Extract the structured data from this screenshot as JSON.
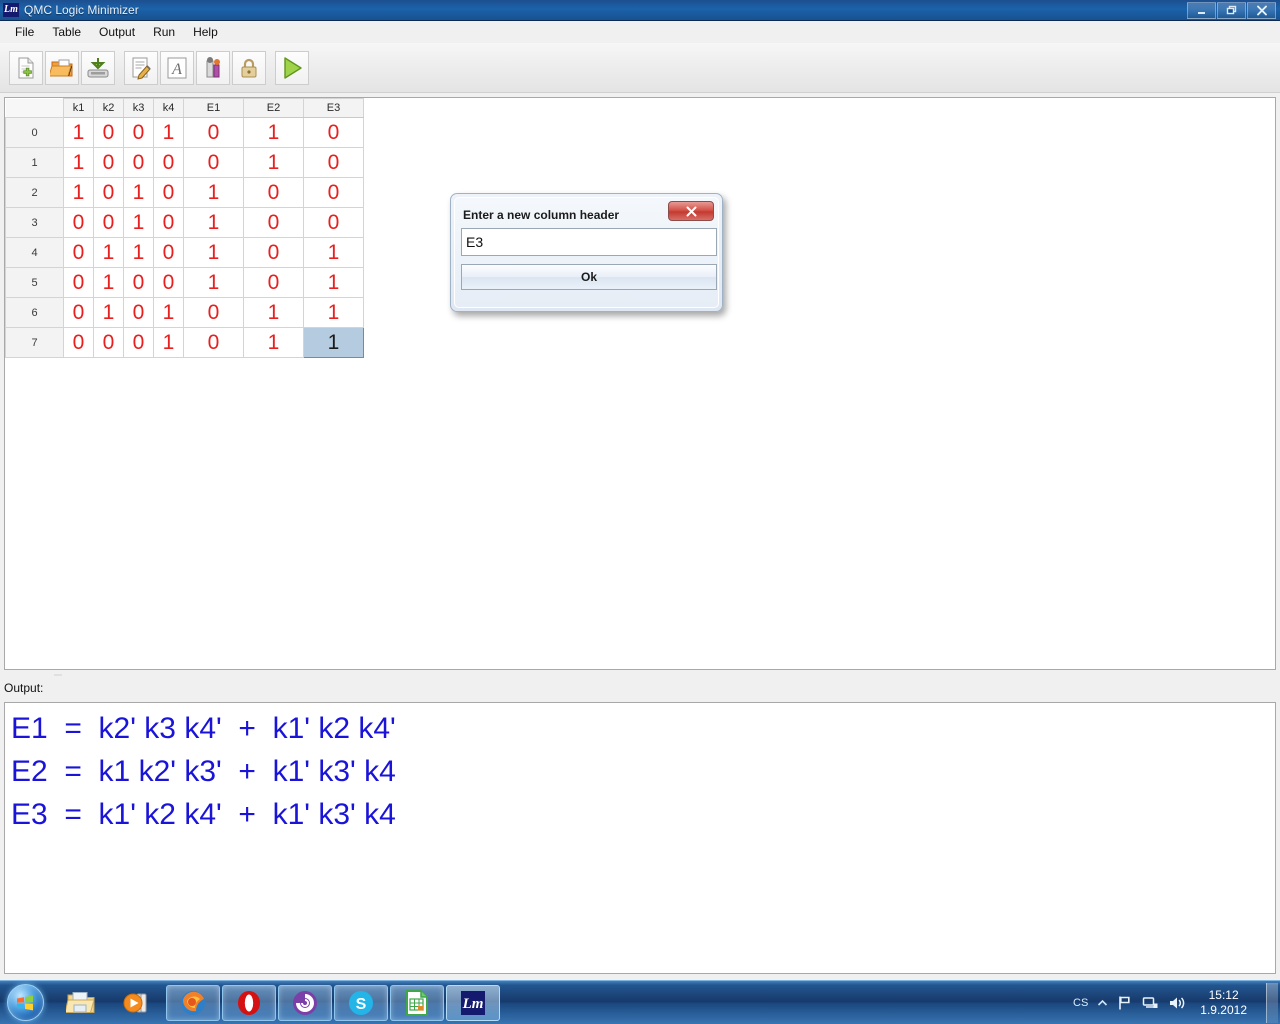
{
  "window": {
    "title": "QMC Logic Minimizer",
    "icon_label": "Lm",
    "controls": {
      "minimize": "—",
      "restore": "❐",
      "close": "✕"
    }
  },
  "menu": {
    "items": [
      {
        "label": "File"
      },
      {
        "label": "Table"
      },
      {
        "label": "Output"
      },
      {
        "label": "Run"
      },
      {
        "label": "Help"
      }
    ]
  },
  "toolbar": {
    "buttons": [
      {
        "name": "new-file-icon",
        "tip": "New"
      },
      {
        "name": "open-folder-icon",
        "tip": "Open"
      },
      {
        "name": "save-disk-icon",
        "tip": "Save"
      },
      {
        "name": "edit-note-icon",
        "tip": "Edit"
      },
      {
        "name": "font-letter-icon",
        "tip": "Font"
      },
      {
        "name": "color-chart-icon",
        "tip": "Colors"
      },
      {
        "name": "lock-icon",
        "tip": "Lock"
      },
      {
        "name": "run-play-icon",
        "tip": "Run"
      }
    ]
  },
  "table": {
    "corner_label": "",
    "columns": [
      "k1",
      "k2",
      "k3",
      "k4",
      "E1",
      "E2",
      "E3"
    ],
    "rows": [
      {
        "index": "0",
        "values": [
          "1",
          "0",
          "0",
          "1",
          "0",
          "1",
          "0"
        ]
      },
      {
        "index": "1",
        "values": [
          "1",
          "0",
          "0",
          "0",
          "0",
          "1",
          "0"
        ]
      },
      {
        "index": "2",
        "values": [
          "1",
          "0",
          "1",
          "0",
          "1",
          "0",
          "0"
        ]
      },
      {
        "index": "3",
        "values": [
          "0",
          "0",
          "1",
          "0",
          "1",
          "0",
          "0"
        ]
      },
      {
        "index": "4",
        "values": [
          "0",
          "1",
          "1",
          "0",
          "1",
          "0",
          "1"
        ]
      },
      {
        "index": "5",
        "values": [
          "0",
          "1",
          "0",
          "0",
          "1",
          "0",
          "1"
        ]
      },
      {
        "index": "6",
        "values": [
          "0",
          "1",
          "0",
          "1",
          "0",
          "1",
          "1"
        ]
      },
      {
        "index": "7",
        "values": [
          "0",
          "0",
          "0",
          "1",
          "0",
          "1",
          "1"
        ]
      }
    ],
    "selected_cell": {
      "row": 7,
      "col": 6
    },
    "cell_color": "#e8201f",
    "selection_bg": "#b4cbe0"
  },
  "output": {
    "label": "Output:",
    "text_color": "#1a14d8",
    "lines": [
      "E1  =  k2' k3 k4'  +  k1' k2 k4'",
      "E2  =  k1 k2' k3'  +  k1' k3' k4",
      "E3  =  k1' k2 k4'  +  k1' k3' k4"
    ]
  },
  "dialog": {
    "title": "Enter a new column header",
    "close_label": "✕",
    "input_value": "E3",
    "input_placeholder": "",
    "ok_label": "Ok"
  },
  "taskbar": {
    "start_name": "windows-start-orb",
    "items": [
      {
        "name": "explorer-icon",
        "state": "pinned"
      },
      {
        "name": "media-player-icon",
        "state": "pinned"
      },
      {
        "name": "firefox-icon",
        "state": "running"
      },
      {
        "name": "opera-icon",
        "state": "running"
      },
      {
        "name": "bittorrent-icon",
        "state": "running"
      },
      {
        "name": "skype-icon",
        "state": "running"
      },
      {
        "name": "libreoffice-calc-icon",
        "state": "running"
      },
      {
        "name": "qmc-logic-minimizer-icon",
        "state": "active",
        "label": "Lm"
      }
    ],
    "tray": {
      "language": "CS",
      "chevron": "▲",
      "icons": [
        "flag-icon",
        "network-icon",
        "volume-icon"
      ],
      "time": "15:12",
      "date": "1.9.2012"
    }
  }
}
